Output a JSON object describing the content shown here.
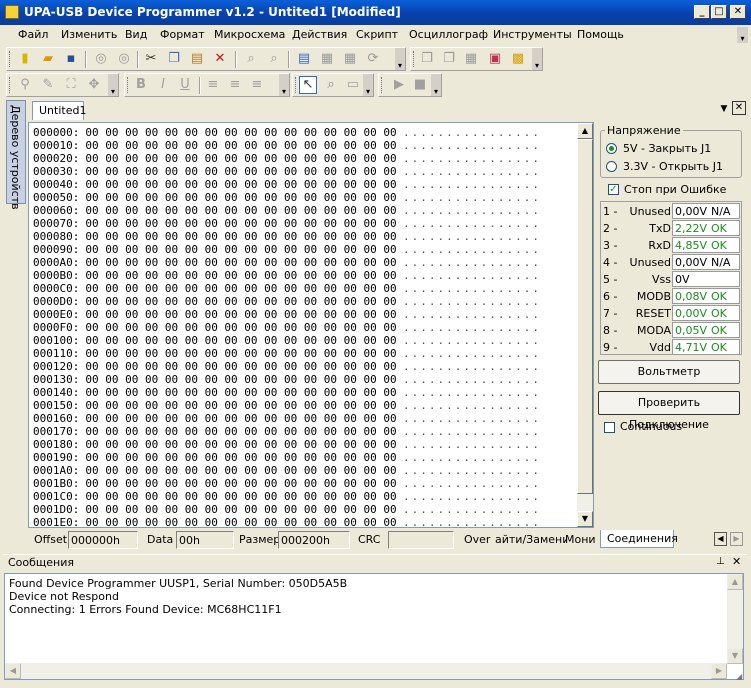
{
  "window": {
    "title": "UPA-USB Device Programmer v1.2 - Untited1 [Modified]",
    "min": "_",
    "max": "□",
    "close": "✕"
  },
  "menu": [
    "Файл",
    "Изменить",
    "Вид",
    "Формат",
    "Микросхема",
    "Действия",
    "Скрипт",
    "Осциллограф",
    "Инструменты",
    "Помощь"
  ],
  "sidebar": {
    "tab_label": "Дерево устройств"
  },
  "document": {
    "tab_label": "Untited1"
  },
  "hex": {
    "rows": [
      "000000:",
      "000010:",
      "000020:",
      "000030:",
      "000040:",
      "000050:",
      "000060:",
      "000070:",
      "000080:",
      "000090:",
      "0000A0:",
      "0000B0:",
      "0000C0:",
      "0000D0:",
      "0000E0:",
      "0000F0:",
      "000100:",
      "000110:",
      "000120:",
      "000130:",
      "000140:",
      "000150:",
      "000160:",
      "000170:",
      "000180:",
      "000190:",
      "0001A0:",
      "0001B0:",
      "0001C0:",
      "0001D0:",
      "0001E0:"
    ],
    "bytes": "00 00 00 00 00 00 00 00 00 00 00 00 00 00 00 00",
    "ascii": "................"
  },
  "status": {
    "offset_label": "Offset",
    "offset_value": "000000h",
    "data_label": "Data",
    "data_value": "00h",
    "size_label": "Размер",
    "size_value": "000200h",
    "crc_label": "CRC",
    "crc_value": "",
    "over_label": "Over",
    "mode_label": "айти/Замени",
    "monitor_label": "Монит"
  },
  "voltage": {
    "legend": "Напряжение",
    "option1": "5V - Закрыть J1",
    "option2": "3.3V - Открыть J1",
    "selected": "5V - Закрыть J1"
  },
  "stop_on_error": {
    "label": "Стоп при Ошибке",
    "checked": true
  },
  "pins": [
    {
      "num": "1 -",
      "name": "Unused",
      "value": "0,00V",
      "status": "N/A"
    },
    {
      "num": "2 -",
      "name": "TxD",
      "value": "2,22V",
      "status": "OK"
    },
    {
      "num": "3 -",
      "name": "RxD",
      "value": "4,85V",
      "status": "OK"
    },
    {
      "num": "4 -",
      "name": "Unused",
      "value": "0,00V",
      "status": "N/A"
    },
    {
      "num": "5 -",
      "name": "Vss",
      "value": "0V",
      "status": ""
    },
    {
      "num": "6 -",
      "name": "MODB",
      "value": "0,08V",
      "status": "OK"
    },
    {
      "num": "7 -",
      "name": "RESET",
      "value": "0,00V",
      "status": "OK"
    },
    {
      "num": "8 -",
      "name": "MODA",
      "value": "0,05V",
      "status": "OK"
    },
    {
      "num": "9 -",
      "name": "Vdd",
      "value": "4,71V",
      "status": "OK"
    }
  ],
  "buttons": {
    "voltmeter": "Вольтметр",
    "check_connection": "Проверить Подключение"
  },
  "continuous": {
    "label": "Continuous",
    "checked": false
  },
  "right_tab": {
    "label": "Соединения"
  },
  "messages": {
    "title": "Сообщения",
    "lines": [
      "Found Device Programmer UUSP1, Serial Number: 050D5A5B",
      "Device not Respond",
      "Connecting:  1 Errors Found   Device: MC68HC11F1"
    ]
  },
  "colors": {
    "title_bar": "#0842ad",
    "ok_green": "#1e8c1e",
    "panel": "#ece9d8"
  }
}
